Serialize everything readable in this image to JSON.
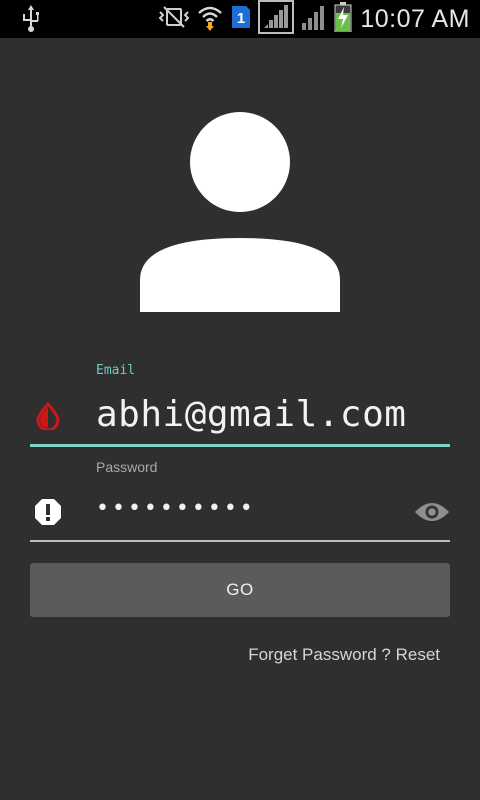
{
  "status_bar": {
    "time": "10:07 AM",
    "sim_badge": "1",
    "icons": [
      "usb-icon",
      "vibrate-icon",
      "wifi-icon",
      "sim-icon",
      "no-signal-icon",
      "signal-icon",
      "battery-icon"
    ]
  },
  "form": {
    "email": {
      "label": "Email",
      "value": "abhi@gmail.com",
      "icon": "water-drop-icon",
      "accent_color": "#7fd3cb"
    },
    "password": {
      "label": "Password",
      "value": "••••••••••",
      "icon": "alert-icon",
      "toggle_icon": "eye-icon"
    },
    "submit_label": "GO",
    "forgot_link": "Forget Password ? Reset"
  },
  "colors": {
    "background": "#2f2f2f",
    "status_bar": "#000000",
    "button": "#5b5b5b",
    "error_icon": "#d01616",
    "accent": "#7fd3cb"
  }
}
